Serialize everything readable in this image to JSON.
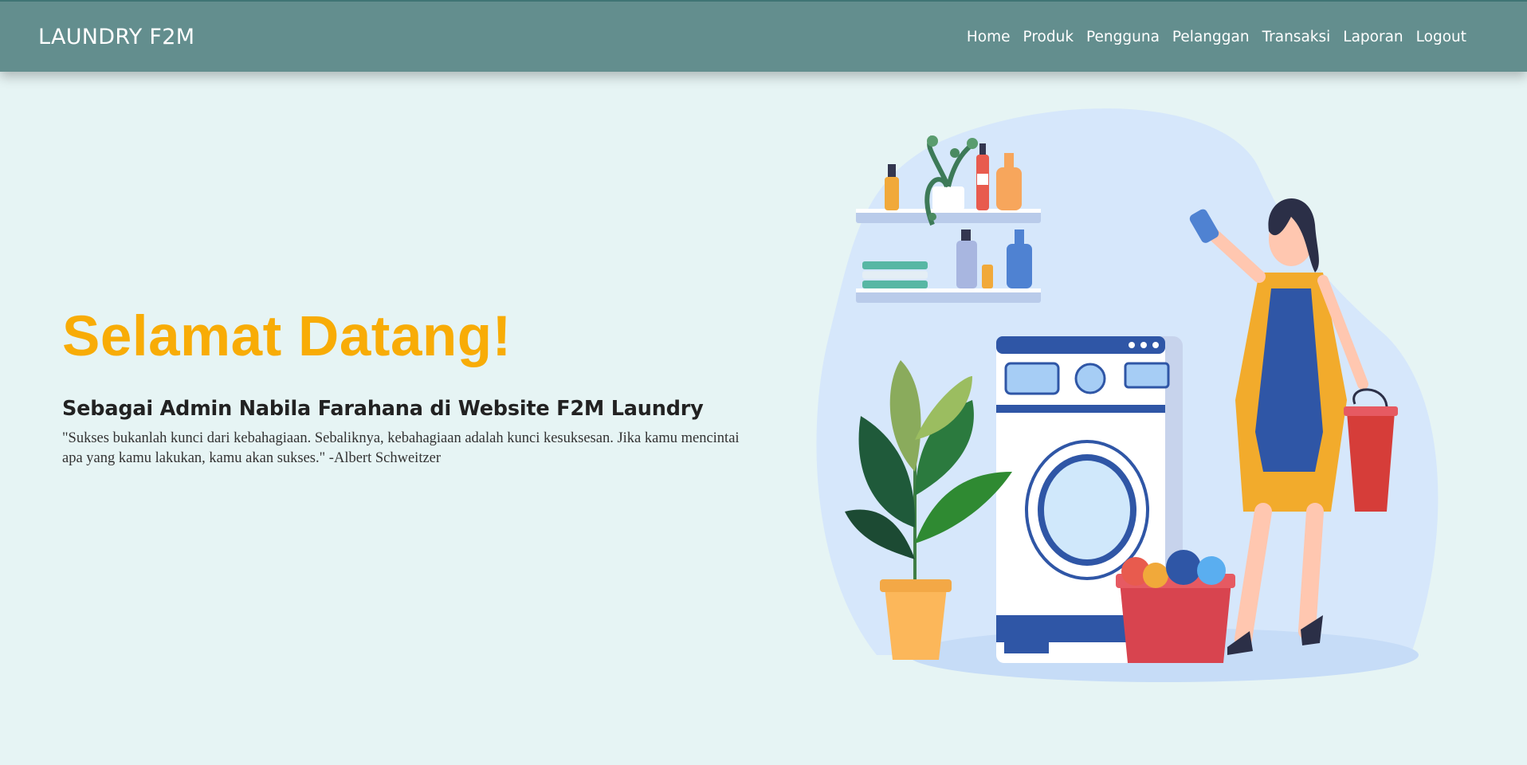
{
  "navbar": {
    "brand": "LAUNDRY F2M",
    "links": [
      {
        "label": "Home"
      },
      {
        "label": "Produk"
      },
      {
        "label": "Pengguna"
      },
      {
        "label": "Pelanggan"
      },
      {
        "label": "Transaksi"
      },
      {
        "label": "Laporan"
      },
      {
        "label": "Logout"
      }
    ]
  },
  "hero": {
    "title": "Selamat Datang!",
    "subtitle": "Sebagai Admin Nabila Farahana di Website F2M Laundry",
    "quote": "\"Sukses bukanlah kunci dari kebahagiaan. Sebaliknya, kebahagiaan adalah kunci kesuksesan. Jika kamu mencintai apa yang kamu lakukan, kamu akan sukses.\" -Albert Schweitzer"
  },
  "illustration": {
    "icon": "laundry-woman-illustration"
  },
  "colors": {
    "navbar_bg": "#638e8e",
    "page_bg": "#e6f4f4",
    "title": "#f8ac06"
  }
}
